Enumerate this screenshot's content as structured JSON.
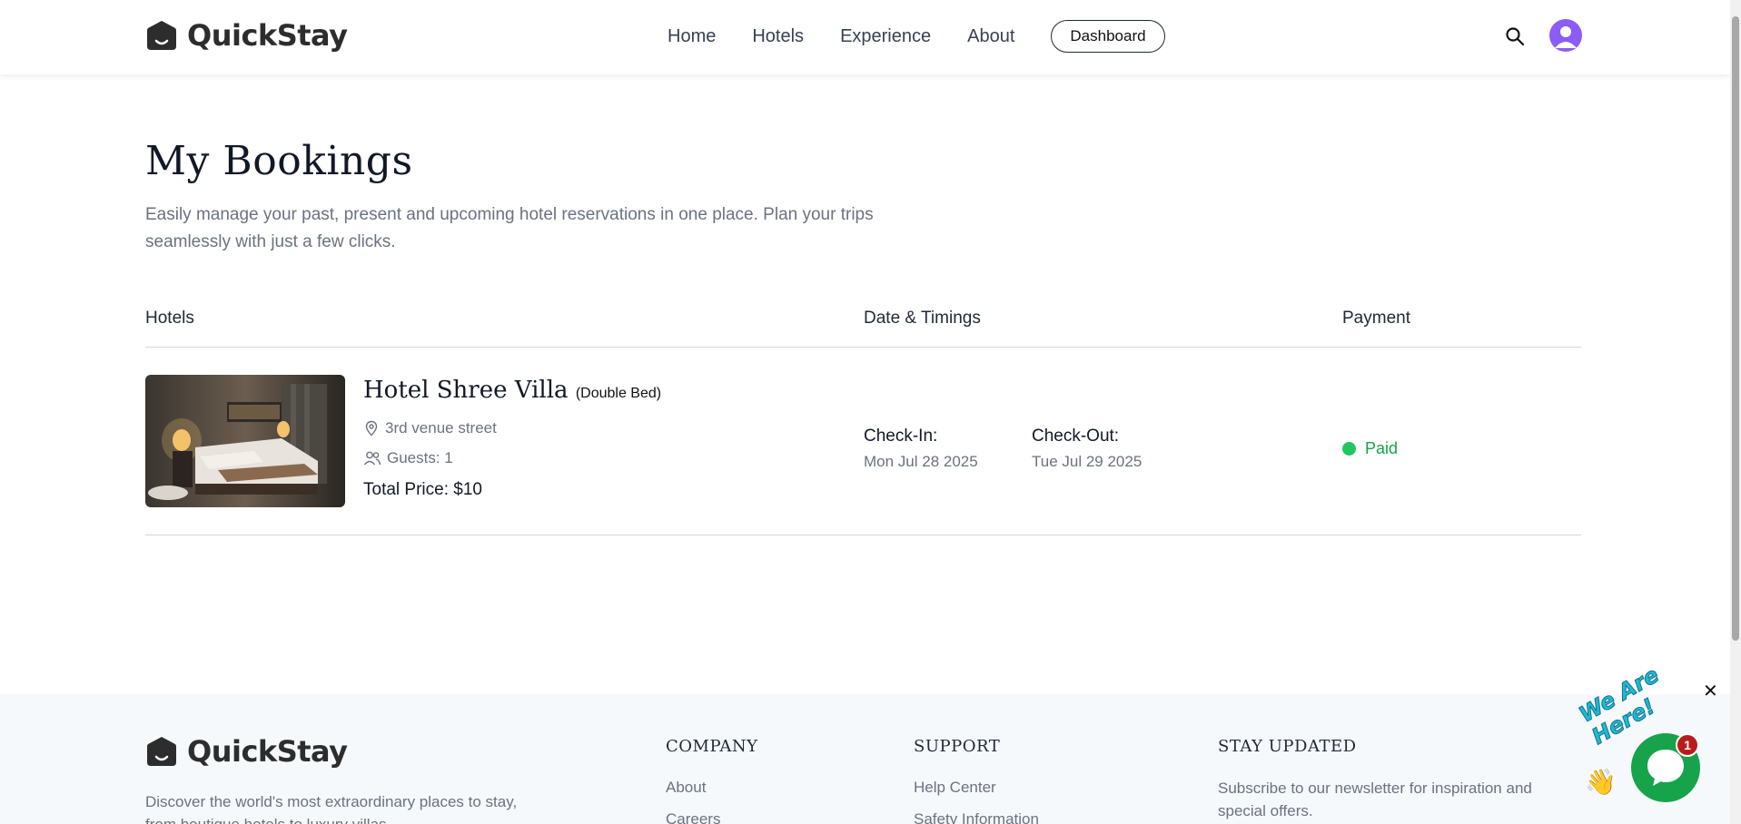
{
  "header": {
    "brand": "QuickStay",
    "nav": [
      {
        "label": "Home"
      },
      {
        "label": "Hotels"
      },
      {
        "label": "Experience"
      },
      {
        "label": "About"
      }
    ],
    "dashboard_label": "Dashboard"
  },
  "page": {
    "title": "My Bookings",
    "subtitle": "Easily manage your past, present and upcoming hotel reservations in one place. Plan your trips seamlessly with just a few clicks."
  },
  "table": {
    "headers": {
      "hotels": "Hotels",
      "dates": "Date & Timings",
      "payment": "Payment"
    },
    "bookings": [
      {
        "hotel_name": "Hotel Shree Villa",
        "room_type": "(Double Bed)",
        "address": "3rd venue street",
        "guests": "Guests: 1",
        "total_price": "Total Price: $10",
        "check_in_label": "Check-In:",
        "check_in": "Mon Jul 28 2025",
        "check_out_label": "Check-Out:",
        "check_out": "Tue Jul 29 2025",
        "payment_status": "Paid"
      }
    ]
  },
  "footer": {
    "brand": "QuickStay",
    "description": "Discover the world's most extraordinary places to stay, from boutique hotels to luxury villas",
    "company_heading": "COMPANY",
    "company_links": [
      "About",
      "Careers"
    ],
    "support_heading": "SUPPORT",
    "support_links": [
      "Help Center",
      "Safety Information"
    ],
    "newsletter_heading": "STAY UPDATED",
    "newsletter_text": "Subscribe to our newsletter for inspiration and special offers."
  },
  "chat_widget": {
    "banner": "We Are Here!",
    "badge_count": "1",
    "close_symbol": "✕"
  },
  "colors": {
    "accent_purple": "#8b5cf6",
    "paid_green": "#22c55e",
    "chat_green": "#16a34a"
  }
}
